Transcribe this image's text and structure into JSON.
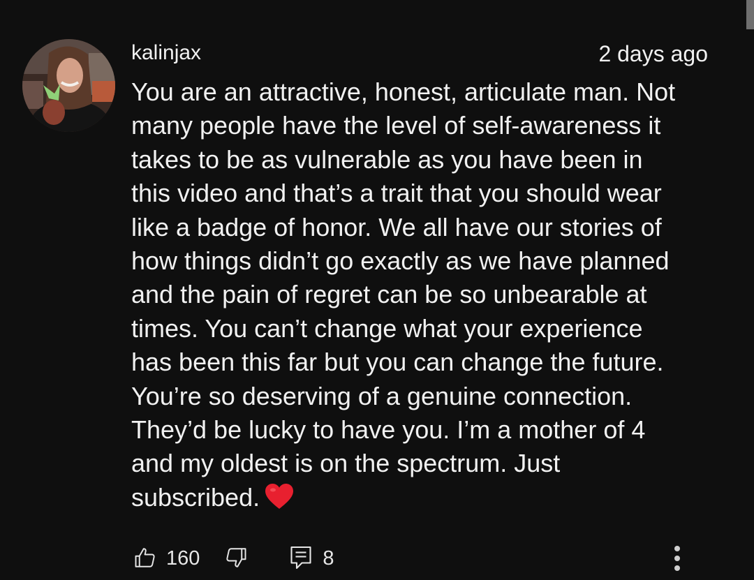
{
  "comment": {
    "author": "kalinjax",
    "timestamp": "2 days ago",
    "text_lines": [
      "You are an attractive, honest, articulate man. Not",
      "many people have the level of self-awareness it",
      "takes to be as vulnerable as you have been in",
      "this video and that’s a trait that you should wear",
      "like a badge of honor. We all have our stories of",
      "how things didn’t go exactly as we have planned",
      "and the pain of regret can be so unbearable at",
      "times. You can’t change what your experience",
      "has been this far but you can change the future.",
      "You’re so deserving of a genuine connection.",
      "They’d be lucky to have you. I’m a mother of 4",
      "and my oldest is on the spectrum. Just",
      "subscribed."
    ],
    "emoji": "heart-emoji"
  },
  "actions": {
    "like_count": "160",
    "reply_count": "8",
    "like_icon": "thumbs-up-icon",
    "dislike_icon": "thumbs-down-icon",
    "reply_icon": "comment-icon",
    "more_icon": "more-vertical-icon"
  },
  "colors": {
    "background": "#0f0f0f",
    "text": "#f1f1f1",
    "heart": "#e8202f"
  }
}
